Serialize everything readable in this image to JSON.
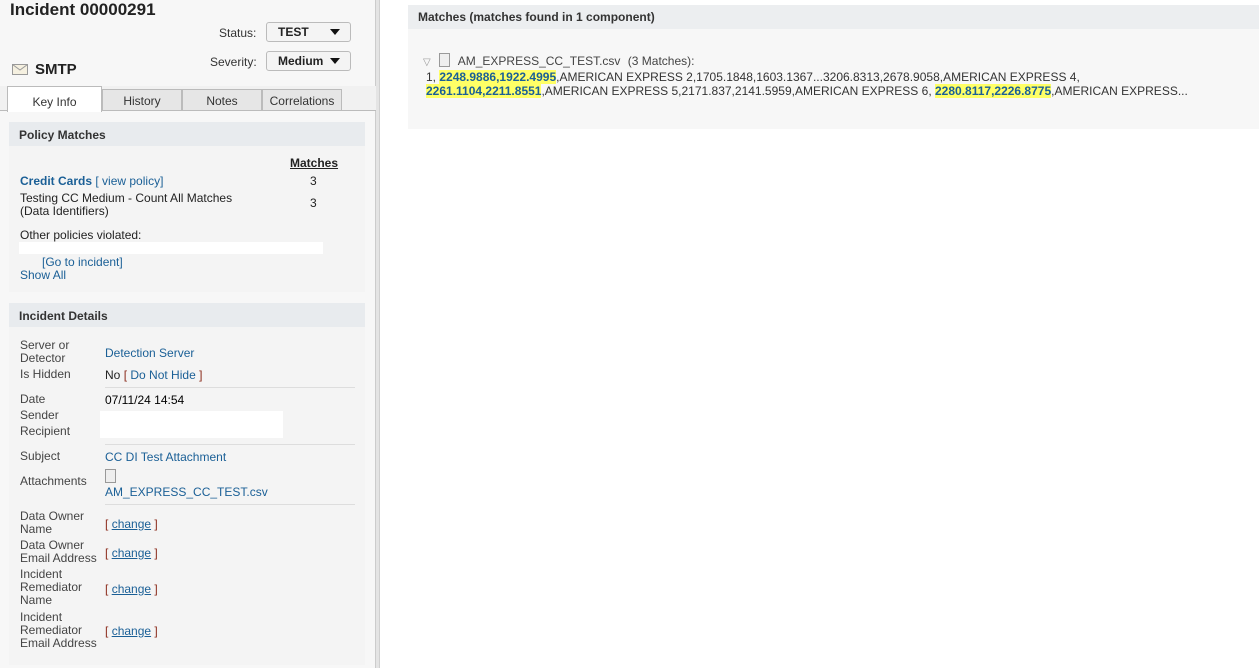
{
  "header": {
    "title": "Incident 00000291",
    "status_label": "Status:",
    "status_value": "TEST",
    "severity_label": "Severity:",
    "severity_value": "Medium",
    "channel": "SMTP"
  },
  "tabs": [
    "Key Info",
    "History",
    "Notes",
    "Correlations"
  ],
  "policy_matches": {
    "title": "Policy Matches",
    "matches_header": "Matches",
    "policy_name": "Credit Cards",
    "view_policy": "[ view policy]",
    "policy_count": "3",
    "rule_line1": "Testing CC Medium - Count All Matches",
    "rule_line2": "(Data Identifiers)",
    "rule_count": "3",
    "other_label": "Other policies violated:",
    "go_to_incident": "[Go to incident]",
    "show_all": "Show All"
  },
  "incident_details": {
    "title": "Incident Details",
    "server_label1": "Server or",
    "server_label2": "Detector",
    "server_value": "Detection Server",
    "hidden_label": "Is Hidden",
    "hidden_value": "No",
    "do_not_hide": "Do Not Hide",
    "date_label": "Date",
    "date_value": "07/11/24 14:54",
    "sender_label": "Sender",
    "recipient_label": "Recipient",
    "subject_label": "Subject",
    "subject_value": "CC DI Test Attachment",
    "attachments_label": "Attachments",
    "attachment_name": "AM_EXPRESS_CC_TEST.csv",
    "owner_name_1": "Data Owner",
    "owner_name_2": "Name",
    "owner_email_1": "Data Owner",
    "owner_email_2": "Email Address",
    "rem_name_1": "Incident",
    "rem_name_2": "Remediator",
    "rem_name_3": "Name",
    "rem_email_1": "Incident",
    "rem_email_2": "Remediator",
    "rem_email_3": "Email Address",
    "change": "change"
  },
  "matches": {
    "title": "Matches (matches found in 1 component)",
    "file": "AM_EXPRESS_CC_TEST.csv",
    "count": "(3 Matches):",
    "segments": [
      {
        "t": "1, ",
        "h": false
      },
      {
        "t": "2248.9886,1922.4995",
        "h": true
      },
      {
        "t": ",AMERICAN EXPRESS 2,1705.1848,1603.1367...3206.8313,2678.9058,AMERICAN EXPRESS 4, ",
        "h": false
      },
      {
        "t": "2261.1104,2211.8551",
        "h": true
      },
      {
        "t": ",AMERICAN EXPRESS 5,2171.837,2141.5959,AMERICAN EXPRESS 6, ",
        "h": false
      },
      {
        "t": "2280.8117,2226.8775",
        "h": true
      },
      {
        "t": ",AMERICAN EXPRESS...",
        "h": false
      }
    ]
  }
}
